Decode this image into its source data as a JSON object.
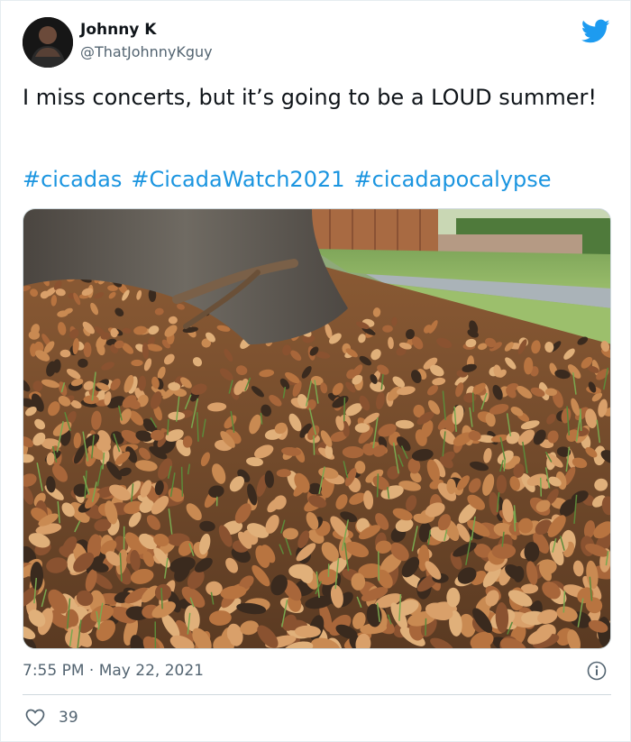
{
  "author": {
    "name": "Johnny K",
    "handle": "@ThatJohnnyKguy",
    "avatar_icon": "profile-photo"
  },
  "brand": {
    "icon": "twitter-bird-icon",
    "color": "#1d9bf0"
  },
  "tweet": {
    "text": "I miss concerts, but it’s going to be a LOUD summer!",
    "hashtags": [
      "#cicadas",
      "#CicadaWatch2021",
      "#cicadapocalypse"
    ],
    "hashtag_color": "#1b95e0"
  },
  "meta": {
    "timestamp": "7:55 PM · May 22, 2021",
    "info_icon": "info-icon"
  },
  "engagement": {
    "like_icon": "heart-icon",
    "like_count": "39"
  }
}
